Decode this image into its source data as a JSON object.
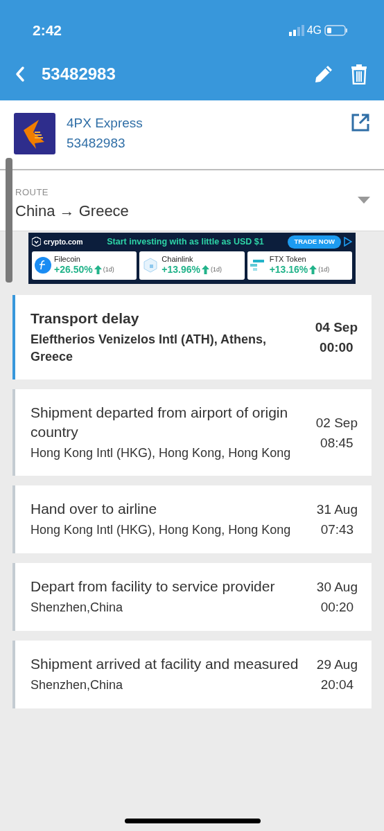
{
  "status_bar": {
    "time": "2:42",
    "network": "4G"
  },
  "header": {
    "title": "53482983"
  },
  "carrier": {
    "name": "4PX Express",
    "tracking_number": "53482983"
  },
  "route": {
    "label": "ROUTE",
    "value": "China → Greece"
  },
  "ad": {
    "brand": "crypto.com",
    "headline": "Start investing with as little as USD $1",
    "cta": "TRADE NOW",
    "coins": [
      {
        "kind": "filecoin",
        "name": "Filecoin",
        "change": "+26.50%",
        "period": "(1d)"
      },
      {
        "kind": "chainlink",
        "name": "Chainlink",
        "change": "+13.96%",
        "period": "(1d)"
      },
      {
        "kind": "ftx",
        "name": "FTX Token",
        "change": "+13.16%",
        "period": "(1d)"
      }
    ]
  },
  "events": [
    {
      "title": "Transport delay",
      "location": "Eleftherios Venizelos Intl (ATH), Athens, Greece",
      "date": "04 Sep",
      "time": "00:00",
      "latest": true
    },
    {
      "title": "Shipment departed from airport of origin country",
      "location": "Hong Kong Intl (HKG), Hong Kong, Hong Kong",
      "date": "02 Sep",
      "time": "08:45",
      "latest": false
    },
    {
      "title": "Hand over to airline",
      "location": "Hong Kong Intl (HKG), Hong Kong, Hong Kong",
      "date": "31 Aug",
      "time": "07:43",
      "latest": false
    },
    {
      "title": "Depart from facility to service provider",
      "location": "Shenzhen,China",
      "date": "30 Aug",
      "time": "00:20",
      "latest": false
    },
    {
      "title": "Shipment arrived at facility and measured",
      "location": "Shenzhen,China",
      "date": "29 Aug",
      "time": "20:04",
      "latest": false
    }
  ]
}
